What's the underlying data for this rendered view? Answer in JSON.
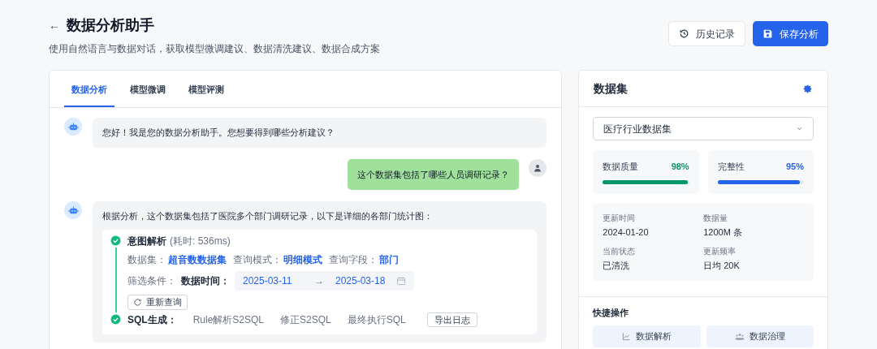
{
  "header": {
    "back": "←",
    "title": "数据分析助手",
    "subtitle": "使用自然语言与数据对话，获取模型微调建议、数据清洗建议、数据合成方案",
    "buttons": [
      {
        "kind": "secondary",
        "label": "历史记录"
      },
      {
        "kind": "primary",
        "label": "保存分析"
      }
    ]
  },
  "tabs": [
    {
      "label": "数据分析",
      "selected": true
    },
    {
      "label": "模型微调",
      "selected": false
    },
    {
      "label": "模型评测",
      "selected": false
    }
  ],
  "messages": [
    {
      "kind": "bot",
      "text": "您好！我是您的数据分析助手。您想要得到哪些分析建议？"
    },
    {
      "kind": "user",
      "text": "这个数据集包括了哪些人员调研记录？"
    },
    {
      "kind": "bot",
      "text": "根据分析，这个数据集包括了医院多个部门调研记录，以下是详细的各部门统计图：",
      "steps": [
        {
          "title": "意图解析",
          "timing": "(耗时: 536ms)",
          "fields": [
            {
              "label": "数据集：",
              "value": "超音数数据集"
            },
            {
              "label": "查询模式：",
              "value": "明细模式"
            },
            {
              "label": "查询字段：",
              "value": "部门"
            }
          ],
          "filter_label": "筛选条件：",
          "filter_name": "数据时间：",
          "date_from": "2025-03-11",
          "date_arrow": "→",
          "date_to": "2025-03-18",
          "action": "重新查询"
        },
        {
          "title": "SQL生成：",
          "links": [
            "Rule解析S2SQL",
            "修正S2SQL",
            "最终执行SQL"
          ],
          "action": "导出日志"
        }
      ]
    }
  ],
  "dataset_panel": {
    "title": "数据集",
    "select_value": "医疗行业数据集",
    "metrics": [
      {
        "label": "数据质量",
        "value": "98%",
        "level": 0.98,
        "color": "#059669"
      },
      {
        "label": "完整性",
        "value": "95%",
        "level": 0.95,
        "color": "#2563eb"
      }
    ],
    "info": [
      {
        "label": "更新时间",
        "value": "2024-01-20"
      },
      {
        "label": "数据量",
        "value": "1200M 条"
      },
      {
        "label": "当前状态",
        "value": "已清洗"
      },
      {
        "label": "更新频率",
        "value": "日均 20K"
      }
    ],
    "quick_title": "快捷操作",
    "quick_actions": [
      {
        "kind": "chart",
        "label": "数据解析"
      },
      {
        "kind": "users",
        "label": "数据治理"
      }
    ]
  }
}
